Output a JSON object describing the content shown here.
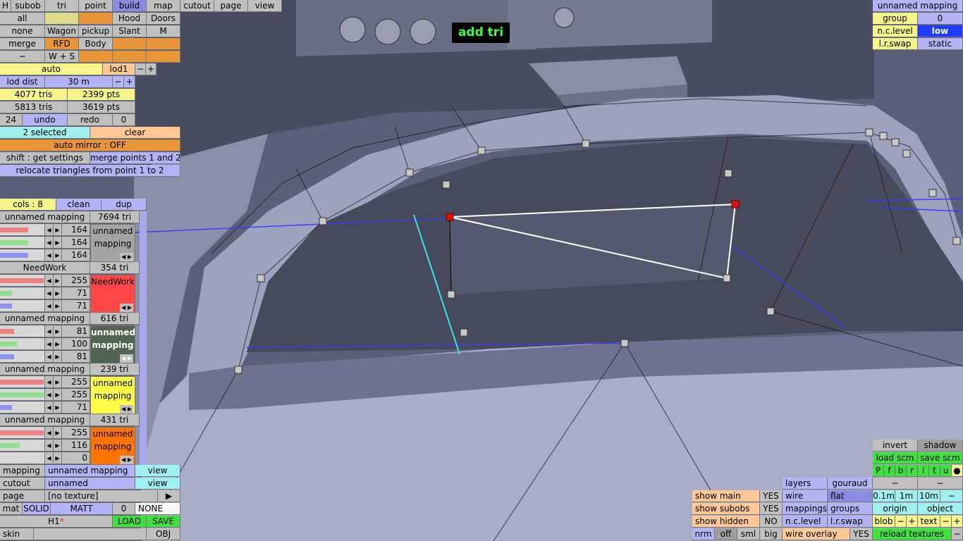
{
  "status_overlay": "add tri",
  "top_tabs": [
    "H",
    "subob",
    "tri",
    "point",
    "build",
    "map",
    "cutout",
    "page",
    "view"
  ],
  "row_all": {
    "all": "all",
    "hood": "Hood",
    "doors": "Doors"
  },
  "row_none": {
    "none": "none",
    "wagon": "Wagon",
    "pickup": "pickup",
    "slant": "Slant",
    "m": "M"
  },
  "row_merge": {
    "merge": "merge",
    "rfd": "RFD",
    "body": "Body"
  },
  "row_minus": {
    "minus": "−",
    "ws": "W + S"
  },
  "lod": {
    "auto": "auto",
    "lod1": "lod1",
    "minus": "−",
    "plus": "+",
    "lod_dist_label": "lod dist",
    "lod_dist_value": "30 m"
  },
  "stats": {
    "tris_a": "4077 tris",
    "pts_a": "2399 pts",
    "tris_b": "5813 tris",
    "pts_b": "3619 pts"
  },
  "undo_row": {
    "count": "24",
    "undo": "undo",
    "redo": "redo",
    "zero": "0"
  },
  "selection": {
    "selected": "2 selected",
    "clear": "clear",
    "auto_mirror": "auto mirror : OFF",
    "shift": "shift : get settings",
    "merge_points": "merge points 1 and 2",
    "relocate": "relocate triangles from point 1 to 2"
  },
  "cols": {
    "label": "cols : 8",
    "clean": "clean",
    "dup": "dup"
  },
  "materials": [
    {
      "name": "unnamed mapping",
      "tri": "7694 tri",
      "r": "164",
      "g": "164",
      "b": "164",
      "label1": "unnamed",
      "label2": "mapping",
      "color": "#a4a4a4",
      "text_color": "#000000",
      "r_frac": 0.64,
      "g_frac": 0.64,
      "b_frac": 0.64
    },
    {
      "name": "NeedWork",
      "tri": "354 tri",
      "r": "255",
      "g": "71",
      "b": "71",
      "label1": "NeedWork",
      "label2": "",
      "color": "#ff4747",
      "text_color": "#000000",
      "r_frac": 1.0,
      "g_frac": 0.28,
      "b_frac": 0.28
    },
    {
      "name": "unnamed mapping",
      "tri": "616 tri",
      "r": "81",
      "g": "100",
      "b": "81",
      "label1": "unnamed",
      "label2": "mapping",
      "color": "#516451",
      "text_color": "#ffffff",
      "r_frac": 0.32,
      "g_frac": 0.39,
      "b_frac": 0.32
    },
    {
      "name": "unnamed mapping",
      "tri": "239 tri",
      "r": "255",
      "g": "255",
      "b": "71",
      "label1": "unnamed",
      "label2": "mapping",
      "color": "#ffff47",
      "text_color": "#000000",
      "r_frac": 1.0,
      "g_frac": 1.0,
      "b_frac": 0.28
    },
    {
      "name": "unnamed mapping",
      "tri": "431 tri",
      "r": "255",
      "g": "116",
      "b": "0",
      "label1": "unnamed",
      "label2": "mapping",
      "color": "#ff7400",
      "text_color": "#000000",
      "r_frac": 1.0,
      "g_frac": 0.45,
      "b_frac": 0.0
    }
  ],
  "bottom_left": {
    "mapping_label": "mapping",
    "mapping_value": "unnamed mapping",
    "view1": "view",
    "cutout_label": "cutout",
    "cutout_value": "unnamed",
    "view2": "view",
    "page_label": "page",
    "page_value": "[no texture]",
    "page_arrow": "▶",
    "mat": "mat",
    "solid": "SOLID",
    "matt": "MATT",
    "zero": "0",
    "none": "NONE",
    "file": "H1",
    "file_mark": "*",
    "load": "LOAD",
    "save": "SAVE",
    "skin": "skin",
    "obj": "OBJ"
  },
  "top_right": {
    "mapping": "unnamed mapping",
    "group_label": "group",
    "group_value": "0",
    "nc_level_label": "n.c.level",
    "nc_level_value": "low",
    "lr_swap": "l.r.swap",
    "static": "static"
  },
  "bottom_right": {
    "invert": "invert",
    "shadow": "shadow",
    "load_scm": "load scm",
    "save_scm": "save scm",
    "pfbrltu": [
      "P",
      "f",
      "b",
      "r",
      "l",
      "t",
      "u",
      "●"
    ],
    "minus1": "−",
    "minus2": "−",
    "sizes": [
      "0.1m",
      "1m",
      "10m",
      "−"
    ],
    "origin": "origin",
    "object": "object",
    "blob": "blob",
    "blob_minus": "−",
    "blob_plus": "+",
    "text": "text",
    "text_minus": "−",
    "text_plus": "+",
    "reload_textures": "reload textures",
    "reload_minus": "−",
    "layers": "layers",
    "gouraud": "gouraud",
    "wire": "wire",
    "flat": "flat",
    "mappings": "mappings",
    "groups": "groups",
    "nc_level": "n.c.level",
    "lr_swap": "l.r.swap",
    "wire_overlay": "wire overlay",
    "wire_overlay_value": "YES",
    "show_main": "show main",
    "show_main_value": "YES",
    "show_subobs": "show subobs",
    "show_subobs_value": "YES",
    "show_hidden": "show hidden",
    "show_hidden_value": "NO",
    "nrm": "nrm",
    "off": "off",
    "sml": "sml",
    "big": "big"
  },
  "colors": {
    "panel_gray": "#c0c0c0",
    "panel_purple": "#b3b3f5",
    "highlight_orange": "#e8953a",
    "accent_blue": "#1e3cff",
    "viewport_bg": "#5a5e74"
  }
}
